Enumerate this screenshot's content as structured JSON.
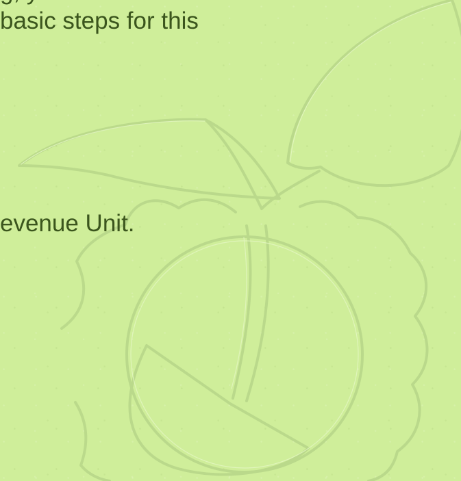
{
  "slide": {
    "line_top": "g, y",
    "line1": "basic steps for this",
    "line2": "evenue Unit."
  },
  "colors": {
    "background": "#cfee9a",
    "text": "#3b551d",
    "watermark_stroke": "#b8d78a",
    "watermark_highlight": "#e4f6c3"
  },
  "icons": {
    "watermark": "sprout-gear-watermark"
  }
}
